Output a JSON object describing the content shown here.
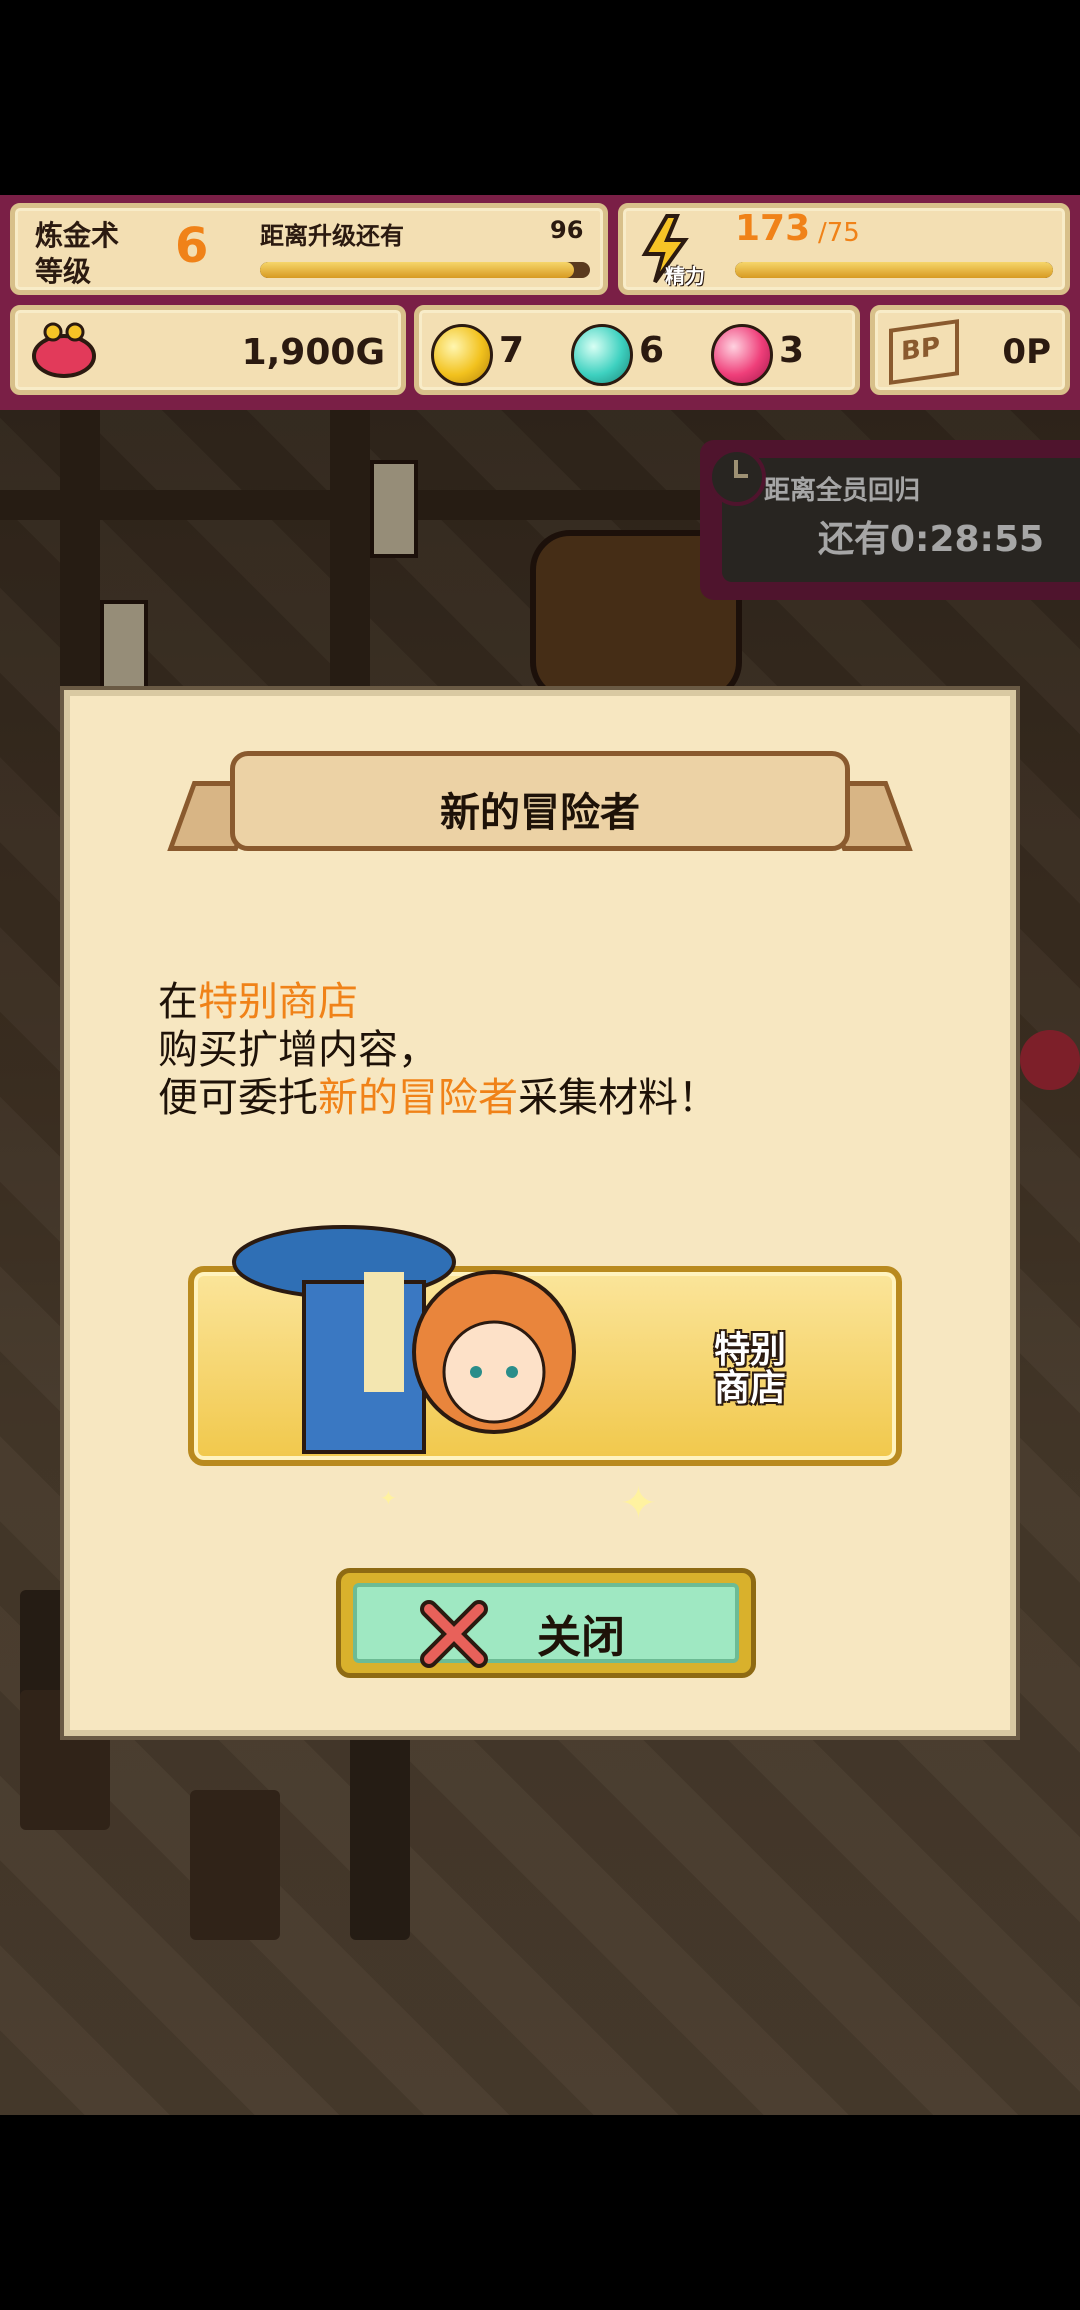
{
  "hud": {
    "alchemy_label_line1": "炼金术",
    "alchemy_label_line2": "等级",
    "level": "6",
    "next_level_label": "距离升级还有",
    "next_level_value": "96",
    "next_level_progress": 0.95,
    "stamina_current": "173",
    "stamina_max": "/75",
    "stamina_label": "精力",
    "stamina_progress": 1.0,
    "gold": "1,900G",
    "orb_yellow": "7",
    "orb_teal": "6",
    "orb_pink": "3",
    "bp_label": "BP",
    "bp_value": "0P"
  },
  "timer": {
    "label": "距离全员回归",
    "value": "还有0:28:55"
  },
  "dialog": {
    "title": "新的冒险者",
    "line1_prefix": "在",
    "line1_highlight": "特别商店",
    "line2": "购买扩增内容，",
    "line3_prefix": "便可委托",
    "line3_highlight": "新的冒险者",
    "line3_suffix": "采集材料！",
    "shop_button_line1": "特别",
    "shop_button_line2": "商店",
    "close_label": "关闭"
  },
  "colors": {
    "hud_frame": "#7a1f46",
    "panel": "#f3dfb3",
    "accent_orange": "#f08218",
    "close_button_fill": "#9fe8c2"
  }
}
